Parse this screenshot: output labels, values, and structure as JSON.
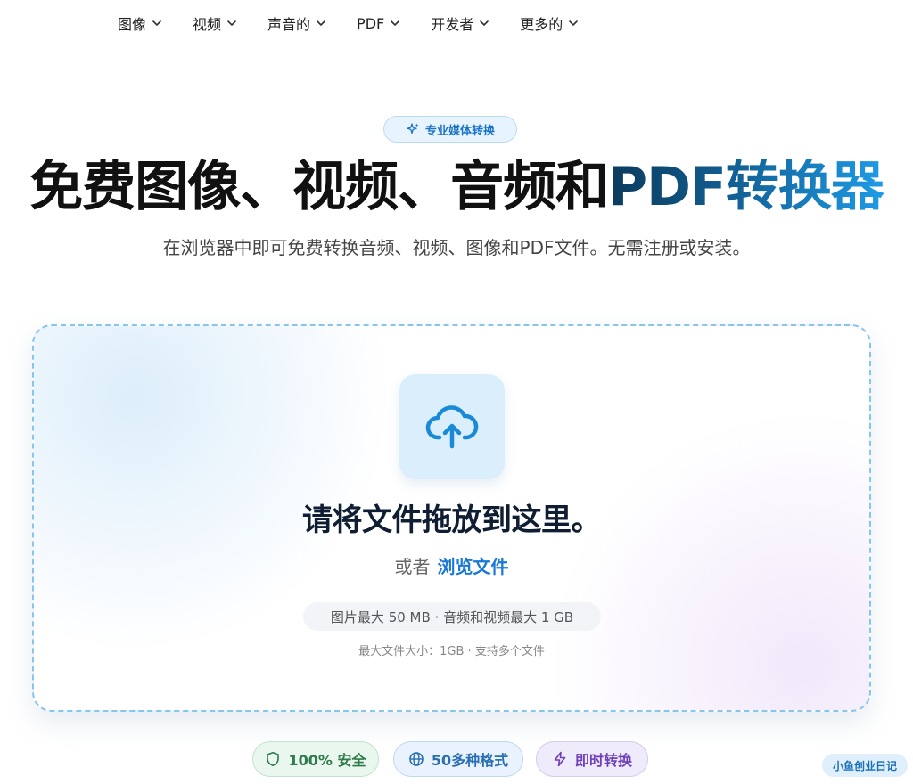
{
  "nav": {
    "items": [
      {
        "label": "图像"
      },
      {
        "label": "视频"
      },
      {
        "label": "声音的"
      },
      {
        "label": "PDF"
      },
      {
        "label": "开发者"
      },
      {
        "label": "更多的"
      }
    ]
  },
  "hero": {
    "badge": "专业媒体转换",
    "title_plain": "免费图像、视频、音频和",
    "title_accent": "PDF转换器",
    "subtitle": "在浏览器中即可免费转换音频、视频、图像和PDF文件。无需注册或安装。"
  },
  "dropzone": {
    "icon": "cloud-upload-icon",
    "title": "请将文件拖放到这里。",
    "or_text": "或者",
    "browse_link": "浏览文件",
    "limits": "图片最大 50 MB · 音频和视频最大 1 GB",
    "note": "最大文件大小：1GB · 支持多个文件"
  },
  "features": [
    {
      "label": "100% 安全",
      "icon": "shield-icon"
    },
    {
      "label": "50多种格式",
      "icon": "globe-icon"
    },
    {
      "label": "即时转换",
      "icon": "lightning-icon"
    }
  ],
  "watermark": "小鱼创业日记",
  "colors": {
    "accent": "#1a78d6",
    "dropzone_border": "#87c6ea",
    "title_gradient_start": "#0b3a5c",
    "title_gradient_end": "#1e9be6"
  }
}
